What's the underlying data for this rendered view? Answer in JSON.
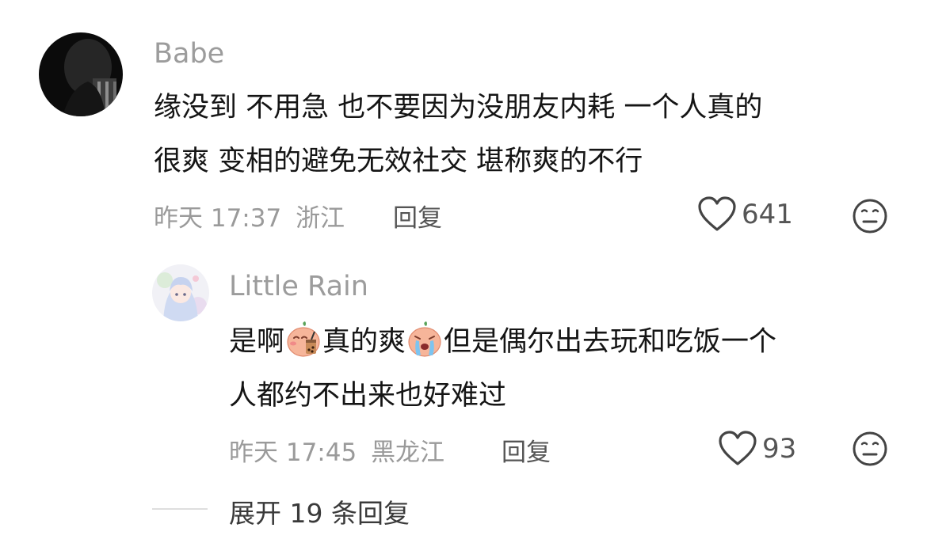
{
  "comments": [
    {
      "username": "Babe",
      "text_lines": [
        "缘没到 不用急 也不要因为没朋友内耗 一个人真的",
        "很爽 变相的避免无效社交 堪称爽的不行"
      ],
      "time": "昨天 17:37",
      "location": "浙江",
      "reply_label": "回复",
      "likes": "641",
      "like_icon": "heart-outline-icon",
      "dislike_icon": "neutral-face-icon"
    }
  ],
  "reply": {
    "username": "Little Rain",
    "text_parts": [
      "是啊",
      "真的爽",
      "但是偶尔出去玩和吃饭一个"
    ],
    "text_line2": "人都约不出来也好难过",
    "emoji_1": "peach-bubble-tea-emoji",
    "emoji_2": "peach-crying-emoji",
    "time": "昨天 17:45",
    "location": "黑龙江",
    "reply_label": "回复",
    "likes": "93"
  },
  "expand_label": "展开 19 条回复"
}
